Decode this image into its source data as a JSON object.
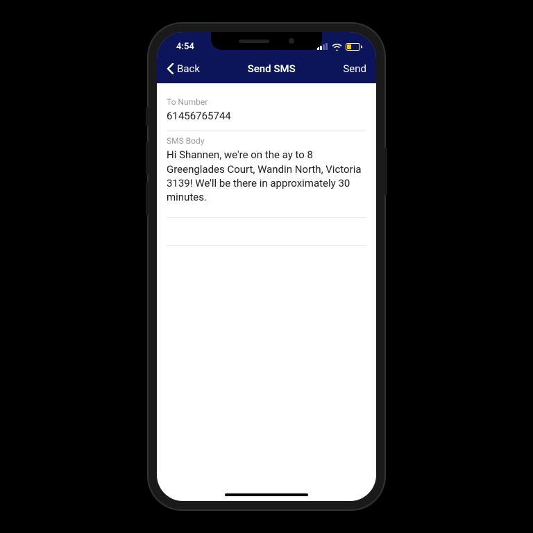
{
  "status": {
    "time": "4:54"
  },
  "nav": {
    "back": "Back",
    "title": "Send SMS",
    "send": "Send"
  },
  "fields": {
    "to_label": "To Number",
    "to_value": "61456765744",
    "body_label": "SMS Body",
    "body_value": "Hi Shannen, we're on the ay to 8 Greenglades Court, Wandin North, Victoria 3139! We'll be there in approximately 30 minutes."
  }
}
